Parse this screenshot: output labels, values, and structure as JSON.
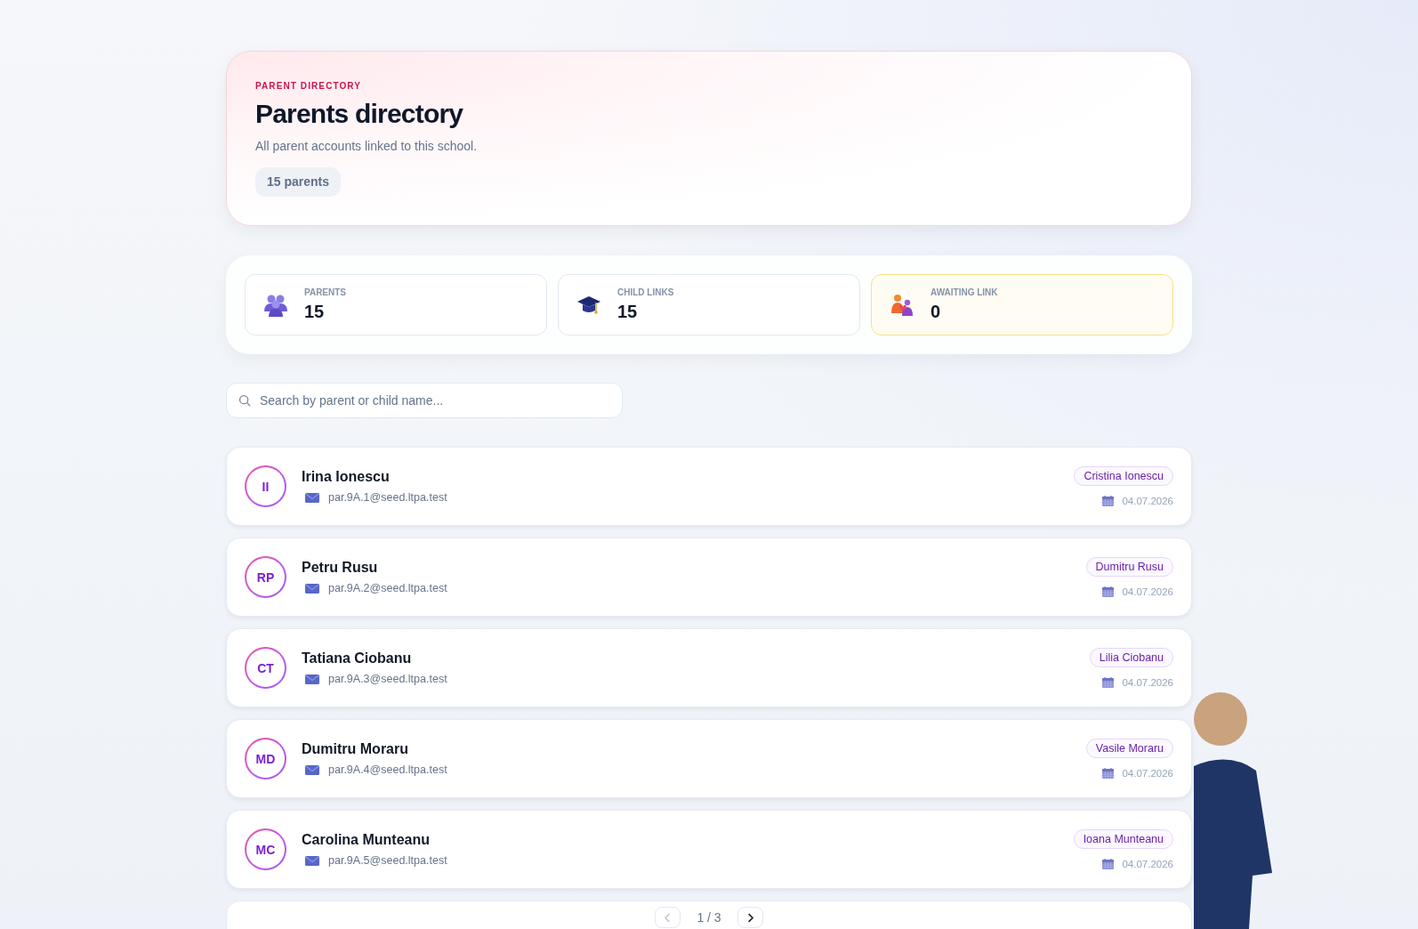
{
  "header": {
    "eyebrow": "PARENT DIRECTORY",
    "title": "Parents directory",
    "subtitle": "All parent accounts linked to this school.",
    "count_badge": "15 parents"
  },
  "stats": [
    {
      "label": "PARENTS",
      "value": "15",
      "kind": "plain"
    },
    {
      "label": "CHILD LINKS",
      "value": "15",
      "kind": "plain"
    },
    {
      "label": "AWAITING LINK",
      "value": "0",
      "kind": "highlight"
    }
  ],
  "search": {
    "placeholder": "Search by parent or child name..."
  },
  "parents": [
    {
      "initials": "II",
      "name": "Irina Ionescu",
      "email": "par.9A.1@seed.ltpa.test",
      "child": "Cristina Ionescu",
      "date": "04.07.2026"
    },
    {
      "initials": "RP",
      "name": "Petru Rusu",
      "email": "par.9A.2@seed.ltpa.test",
      "child": "Dumitru Rusu",
      "date": "04.07.2026"
    },
    {
      "initials": "CT",
      "name": "Tatiana Ciobanu",
      "email": "par.9A.3@seed.ltpa.test",
      "child": "Lilia Ciobanu",
      "date": "04.07.2026"
    },
    {
      "initials": "MD",
      "name": "Dumitru Moraru",
      "email": "par.9A.4@seed.ltpa.test",
      "child": "Vasile Moraru",
      "date": "04.07.2026"
    },
    {
      "initials": "MC",
      "name": "Carolina Munteanu",
      "email": "par.9A.5@seed.ltpa.test",
      "child": "Ioana Munteanu",
      "date": "04.07.2026"
    }
  ],
  "pagination": {
    "label": "1 / 3",
    "prev": {
      "disabled": true
    },
    "next": {
      "disabled": false
    }
  }
}
